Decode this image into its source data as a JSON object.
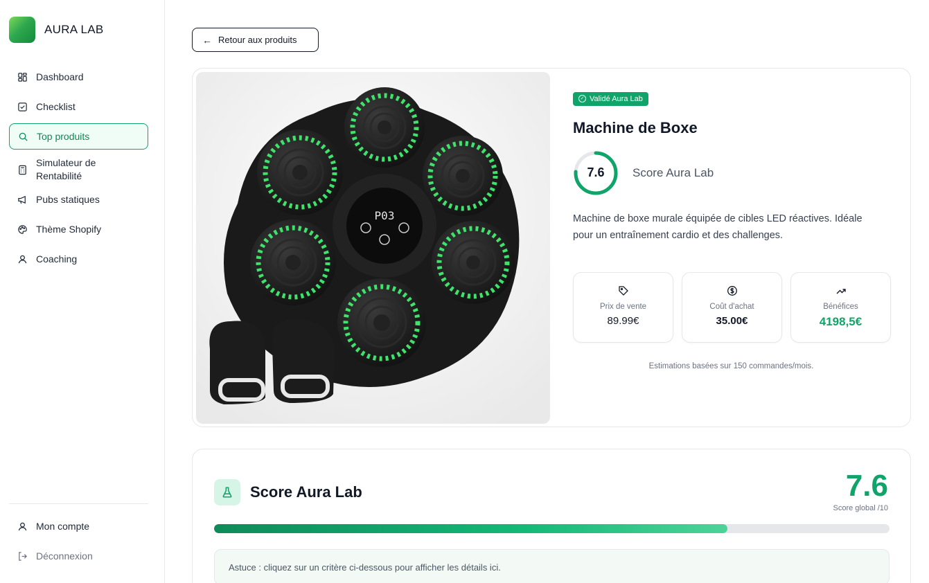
{
  "brand": {
    "name": "AURA LAB"
  },
  "nav": {
    "items": [
      {
        "label": "Dashboard",
        "icon": "dashboard-icon"
      },
      {
        "label": "Checklist",
        "icon": "checklist-icon"
      },
      {
        "label": "Top produits",
        "icon": "search-icon",
        "active": true
      },
      {
        "label": "Simulateur de Rentabilité",
        "icon": "calculator-icon"
      },
      {
        "label": "Pubs statiques",
        "icon": "megaphone-icon"
      },
      {
        "label": "Thème Shopify",
        "icon": "palette-icon"
      },
      {
        "label": "Coaching",
        "icon": "user-icon"
      }
    ],
    "bottom": [
      {
        "label": "Mon compte",
        "icon": "user-icon"
      },
      {
        "label": "Déconnexion",
        "icon": "logout-icon"
      }
    ]
  },
  "back_button": {
    "label": "Retour aux produits"
  },
  "product": {
    "badge": "Validé Aura Lab",
    "title": "Machine de Boxe",
    "score": "7.6",
    "score_fraction": 0.76,
    "score_label": "Score Aura Lab",
    "description": "Machine de boxe murale équipée de cibles LED réactives. Idéale pour un entraînement cardio et des challenges.",
    "image_display": "P03",
    "stats": [
      {
        "label": "Prix de vente",
        "value": "89.99€",
        "icon": "tag-icon"
      },
      {
        "label": "Coût d'achat",
        "value": "35.00€",
        "icon": "dollar-icon"
      },
      {
        "label": "Bénéfices",
        "value": "4198,5€",
        "icon": "trending-up-icon"
      }
    ],
    "estimation_note": "Estimations basées sur 150 commandes/mois."
  },
  "score_section": {
    "title": "Score Aura Lab",
    "score": "7.6",
    "subtitle": "Score global /10",
    "progress_fraction": 0.76,
    "tip": "Astuce : cliquez sur un critère ci-dessous pour afficher les détails ici."
  },
  "colors": {
    "accent": "#10a36a",
    "brand_green": "#2fa84f",
    "active_bg": "#f0fdf6"
  }
}
